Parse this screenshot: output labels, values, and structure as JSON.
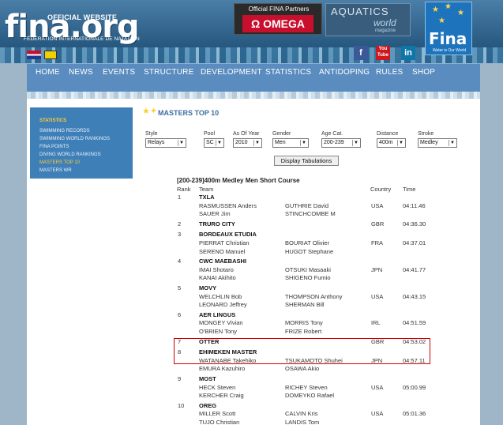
{
  "header": {
    "logo_small": "OFFICIAL WEBSITE",
    "logo_big": "fina.org",
    "logo_fed": "FÉDÉRATION INTERNATIONALE DE NATATION",
    "partners_label": "Official FINA Partners",
    "omega_label": "Ω OMEGA",
    "aquatics_title": "AQUATICS",
    "aquatics_world": "world",
    "aquatics_mag": "magazine",
    "badge_name": "Fina",
    "badge_tagline": "Water is Our World"
  },
  "nav": [
    {
      "label": "HOME"
    },
    {
      "label": "NEWS"
    },
    {
      "label": "EVENTS"
    },
    {
      "label": "STRUCTURE"
    },
    {
      "label": "DEVELOPMENT"
    },
    {
      "label": "STATISTICS"
    },
    {
      "label": "ANTIDOPING"
    },
    {
      "label": "RULES"
    },
    {
      "label": "SHOP"
    }
  ],
  "sidebar": {
    "title": "STATISTICS",
    "items": [
      "SWIMMING RECORDS",
      "SWIMMING WORLD RANKINGS",
      "FINA POINTS",
      "DIVING WORLD RANKINGS",
      "MASTERS TOP 10",
      "MASTERS WR"
    ]
  },
  "page_title": "MASTERS TOP 10",
  "filters": {
    "style": {
      "label": "Style",
      "value": "Relays"
    },
    "pool": {
      "label": "Pool",
      "value": "SC"
    },
    "year": {
      "label": "As Of Year",
      "value": "2010"
    },
    "gender": {
      "label": "Gender",
      "value": "Men"
    },
    "age": {
      "label": "Age Cat.",
      "value": "200-239"
    },
    "distance": {
      "label": "Distance",
      "value": "400m"
    },
    "stroke": {
      "label": "Stroke",
      "value": "Medley"
    }
  },
  "display_button": "Display Tabulations",
  "results": {
    "heading": "[200-239]400m Medley Men Short Course",
    "columns": {
      "rank": "Rank",
      "team": "Team",
      "country": "Country",
      "time": "Time"
    },
    "rows": [
      {
        "rank": "1",
        "team": "TXLA",
        "country": "USA",
        "time": "04:11.46",
        "swimmers": [
          "RASMUSSEN Anders",
          "GUTHRIE David",
          "SAUER Jim",
          "STINCHCOMBE M"
        ]
      },
      {
        "rank": "2",
        "team": "TRURO CITY",
        "country": "GBR",
        "time": "04:36.30",
        "swimmers": []
      },
      {
        "rank": "3",
        "team": "BORDEAUX ETUDIA",
        "country": "FRA",
        "time": "04:37.01",
        "swimmers": [
          "PIERRAT Christian",
          "BOURIAT Olivier",
          "SERENO Manuel",
          "HUGOT Stephane"
        ]
      },
      {
        "rank": "4",
        "team": "CWC MAEBASHI",
        "country": "JPN",
        "time": "04:41.77",
        "swimmers": [
          "IMAI Shotaro",
          "OTSUKI Masaaki",
          "KANAI Akihito",
          "SHIGENO Fumio"
        ]
      },
      {
        "rank": "5",
        "team": "MOVY",
        "country": "USA",
        "time": "04:43.15",
        "swimmers": [
          "WELCHLIN Bob",
          "THOMPSON Anthony",
          "LEONARD Jeffrey",
          "SHERMAN Bill"
        ]
      },
      {
        "rank": "6",
        "team": "AER LINGUS",
        "country": "IRL",
        "time": "04:51.59",
        "swimmers": [
          "MONGEY Vivian",
          "MORRIS Tony",
          "O'BRIEN Tony",
          "FRIZE Robert"
        ]
      },
      {
        "rank": "7",
        "team": "OTTER",
        "country": "GBR",
        "time": "04:53.02",
        "swimmers": []
      },
      {
        "rank": "8",
        "team": "EHIMEKEN MASTER",
        "country": "JPN",
        "time": "04:57.11",
        "swimmers": [
          "WATANABE Takehiko",
          "TSUKAMOTO Shuhei",
          "EMURA Kazuhiro",
          "OSAWA Akio"
        ]
      },
      {
        "rank": "9",
        "team": "MOST",
        "country": "USA",
        "time": "05:00.99",
        "swimmers": [
          "HECK Steven",
          "RICHEY Steven",
          "KERCHER Craig",
          "DOMEYKO Rafael"
        ]
      },
      {
        "rank": "10",
        "team": "OREG",
        "country": "USA",
        "time": "05:01.36",
        "swimmers": [
          "MILLER Scott",
          "CALVIN Kris",
          "TUJO Christian",
          "LANDIS Tom"
        ]
      }
    ]
  }
}
